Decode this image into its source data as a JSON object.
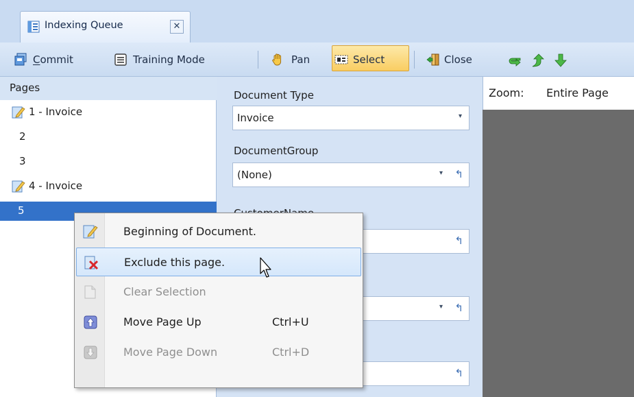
{
  "tab": {
    "title": "Indexing Queue",
    "close_glyph": "✕"
  },
  "toolbar": {
    "commit_first": "C",
    "commit_rest": "ommit",
    "training_mode": "Training Mode",
    "pan": "Pan",
    "select": "Select",
    "close": "Close",
    "icons": [
      "commit-icon",
      "training-mode-icon",
      "pan-hand-icon",
      "select-icon",
      "close-door-icon",
      "next-arrow-icon",
      "move-up-arrow-icon",
      "move-down-arrow-icon"
    ]
  },
  "pages": {
    "header": "Pages",
    "items": [
      {
        "label": "1 - Invoice",
        "icon": "document-start-icon"
      },
      {
        "label": "2"
      },
      {
        "label": "3"
      },
      {
        "label": "4 - Invoice",
        "icon": "document-start-icon"
      },
      {
        "label": "5",
        "selected": true
      }
    ]
  },
  "fields": {
    "document_type_label": "Document Type",
    "document_type_value": "Invoice",
    "document_group_label": "DocumentGroup",
    "document_group_value": "(None)",
    "customer_name_label": "CustomerName",
    "undo_glyph": "↰",
    "dropdown_glyph": "▾"
  },
  "zoom": {
    "label": "Zoom:",
    "value": "Entire Page"
  },
  "context_menu": {
    "items": [
      {
        "label": "Beginning of Document.",
        "shortcut": "",
        "enabled": true,
        "hover": false,
        "icon": "document-start-icon"
      },
      {
        "label": "Exclude this page.",
        "shortcut": "",
        "enabled": true,
        "hover": true,
        "icon": "exclude-page-icon"
      },
      {
        "label": "Clear Selection",
        "shortcut": "",
        "enabled": false,
        "hover": false,
        "icon": "blank-page-icon"
      },
      {
        "label": "Move Page Up",
        "shortcut": "Ctrl+U",
        "enabled": true,
        "hover": false,
        "icon": "move-up-icon"
      },
      {
        "label": "Move Page Down",
        "shortcut": "Ctrl+D",
        "enabled": false,
        "hover": false,
        "icon": "move-down-icon"
      }
    ]
  },
  "colors": {
    "selection": "#3372c9",
    "toolbar_active": "#f9cd62",
    "panel_bg": "#d5e3f5",
    "preview_bg": "#6b6b6b"
  }
}
